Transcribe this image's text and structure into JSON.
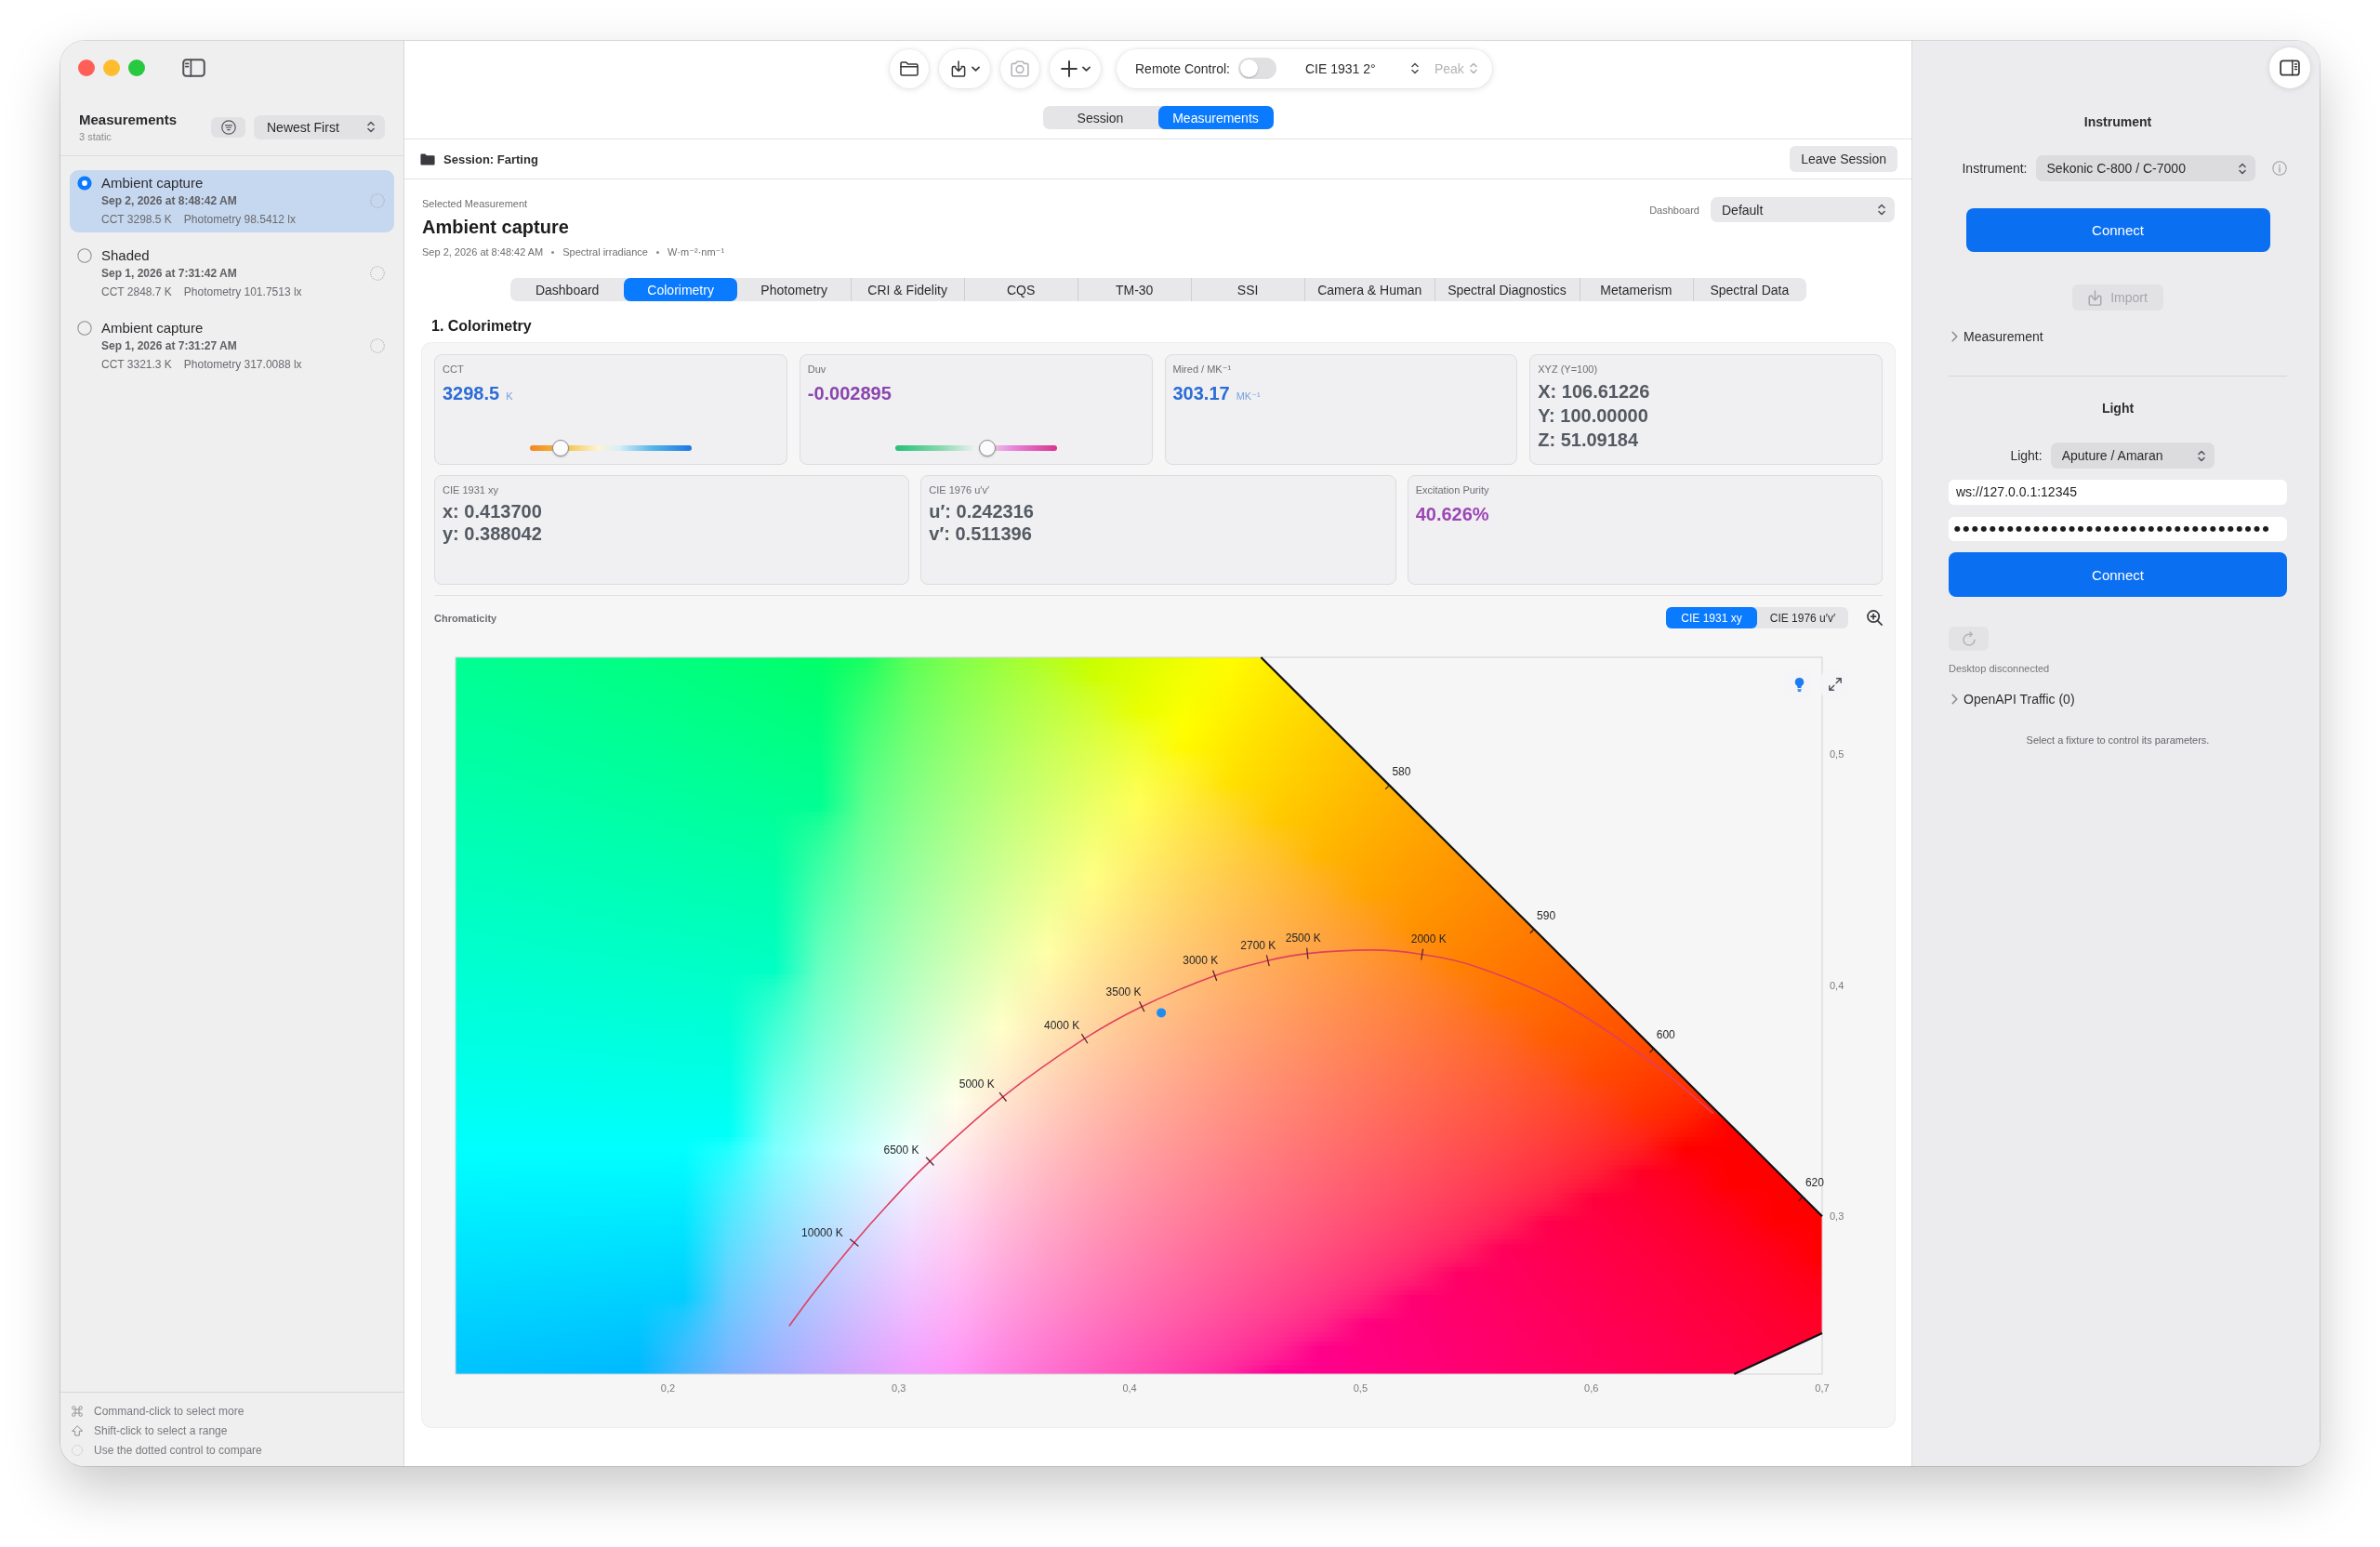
{
  "toolbar": {
    "buttons": [
      {
        "kind": "folder",
        "menu": false,
        "disabled": false
      },
      {
        "kind": "import",
        "menu": true,
        "disabled": false
      },
      {
        "kind": "camera",
        "menu": false,
        "disabled": true
      },
      {
        "kind": "add",
        "menu": true,
        "disabled": false
      }
    ],
    "remote_control": {
      "label": "Remote Control:",
      "on": false
    },
    "observer": "CIE 1931 2°",
    "mode": {
      "value": "Peak",
      "disabled": true
    }
  },
  "view_switch": [
    {
      "label": "Session",
      "selected": false
    },
    {
      "label": "Measurements",
      "selected": true
    }
  ],
  "sidebar": {
    "title": "Measurements",
    "subtitle": "3 static",
    "sort": "Newest First",
    "items": [
      {
        "title": "Ambient capture",
        "date": "Sep 2, 2026 at 8:48:42 AM",
        "cct": "CCT 3298.5 K",
        "photometry": "Photometry 98.5412 lx",
        "selected": true,
        "compared": false
      },
      {
        "title": "Shaded",
        "date": "Sep 1, 2026 at 7:31:42 AM",
        "cct": "CCT 2848.7 K",
        "photometry": "Photometry 101.7513 lx",
        "selected": false,
        "compared": false
      },
      {
        "title": "Ambient capture",
        "date": "Sep 1, 2026 at 7:31:27 AM",
        "cct": "CCT 3321.3 K",
        "photometry": "Photometry 317.0088 lx",
        "selected": false,
        "compared": false
      }
    ],
    "hints": [
      {
        "kind": "command",
        "text": "Command-click to select more"
      },
      {
        "kind": "shift",
        "text": "Shift-click to select a range"
      },
      {
        "kind": "compare",
        "text": "Use the dotted control to compare"
      }
    ]
  },
  "session": {
    "title": "Session: Farting",
    "leave": "Leave Session"
  },
  "measurement": {
    "caption": "Selected Measurement",
    "title": "Ambient capture",
    "meta": [
      "Sep 2, 2026 at 8:48:42 AM",
      "Spectral irradiance",
      "W·m⁻²·nm⁻¹"
    ],
    "dashboard_label": "Dashboard",
    "dashboard": "Default"
  },
  "tabs": [
    {
      "label": "Dashboard",
      "selected": false
    },
    {
      "label": "Colorimetry",
      "selected": true
    },
    {
      "label": "Photometry",
      "selected": false
    },
    {
      "label": "CRI & Fidelity",
      "selected": false
    },
    {
      "label": "CQS",
      "selected": false
    },
    {
      "label": "TM-30",
      "selected": false
    },
    {
      "label": "SSI",
      "selected": false
    },
    {
      "label": "Camera & Human",
      "selected": false
    },
    {
      "label": "Spectral Diagnostics",
      "selected": false
    },
    {
      "label": "Metamerism",
      "selected": false
    },
    {
      "label": "Spectral Data",
      "selected": false
    }
  ],
  "section_title": "1. Colorimetry",
  "metrics": [
    {
      "cards": [
        {
          "kind": "value",
          "label": "CCT",
          "value": "3298.5",
          "unit": "K",
          "color": "#2b6cd6",
          "gauge": {
            "kind": "cct",
            "level": 0.19
          }
        },
        {
          "kind": "value",
          "label": "Duv",
          "value": "-0.002895",
          "color": "#8a45ae",
          "gauge": {
            "kind": "duv",
            "level": 0.57
          }
        },
        {
          "kind": "value",
          "label": "Mired / MK⁻¹",
          "value": "303.17",
          "unit": "MK⁻¹",
          "color": "#2b6cd6"
        },
        {
          "kind": "lines",
          "label": "XYZ (Y=100)",
          "lines": [
            "X: 106.61226",
            "Y: 100.00000",
            "Z: 51.09184"
          ]
        }
      ]
    },
    {
      "cards": [
        {
          "kind": "lines",
          "label": "CIE 1931 xy",
          "lines": [
            "x: 0.413700",
            "y: 0.388042"
          ]
        },
        {
          "kind": "lines",
          "label": "CIE 1976 u′v′",
          "lines": [
            "u′: 0.242316",
            "v′: 0.511396"
          ]
        },
        {
          "kind": "value",
          "label": "Excitation Purity",
          "value": "40.626%",
          "color": "#9c46b6"
        }
      ]
    }
  ],
  "chromaticity": {
    "modes": [
      {
        "label": "CIE 1931 xy",
        "selected": true
      },
      {
        "label": "CIE 1976 u′v′",
        "selected": false
      }
    ],
    "chart_data": {
      "type": "line",
      "title": "Chromaticity",
      "xlim": [
        0.108,
        0.7
      ],
      "ylim": [
        0.2315,
        0.542
      ],
      "xticks": [
        {
          "value": 0.2,
          "label": "0,2"
        },
        {
          "value": 0.3,
          "label": "0,3"
        },
        {
          "value": 0.4,
          "label": "0,4"
        },
        {
          "value": 0.5,
          "label": "0,5"
        },
        {
          "value": 0.6,
          "label": "0,6"
        },
        {
          "value": 0.7,
          "label": "0,7"
        }
      ],
      "yticks": [
        {
          "value": 0.3,
          "label": "0,3"
        },
        {
          "value": 0.4,
          "label": "0,4"
        },
        {
          "value": 0.5,
          "label": "0,5"
        }
      ],
      "series": [
        {
          "color": "#111111",
          "x": [
            0.4569,
            0.4788,
            0.5125,
            0.5448,
            0.5752,
            0.6029,
            0.627,
            0.6482,
            0.6658,
            0.6801,
            0.6915,
            0.7
          ],
          "values": [
            0.542,
            0.5202,
            0.4866,
            0.4544,
            0.4242,
            0.3965,
            0.3725,
            0.3514,
            0.334,
            0.3197,
            0.3083,
            0.2999
          ]
        },
        {
          "color": "#111111",
          "x": [
            0.6619,
            0.7
          ],
          "values": [
            0.2315,
            0.2492
          ]
        },
        {
          "color": "#e0405e",
          "x": [
            0.2525,
            0.2637,
            0.2807,
            0.2952,
            0.3135,
            0.3451,
            0.3805,
            0.4053,
            0.4369,
            0.4599,
            0.477,
            0.5056,
            0.5267,
            0.5494,
            0.5857,
            0.6251,
            0.6528
          ],
          "values": [
            0.2523,
            0.2674,
            0.2884,
            0.3048,
            0.3237,
            0.3516,
            0.3768,
            0.3907,
            0.4041,
            0.4106,
            0.4137,
            0.4152,
            0.4133,
            0.4082,
            0.3931,
            0.3674,
            0.3444
          ]
        },
        {
          "color": "#1f8cf0",
          "marker": "circle",
          "x": [
            0.4137
          ],
          "values": [
            0.388
          ]
        }
      ],
      "annotations": [
        {
          "text": "580",
          "x": 0.5125,
          "y": 0.4866
        },
        {
          "text": "590",
          "x": 0.5752,
          "y": 0.4242
        },
        {
          "text": "600",
          "x": 0.627,
          "y": 0.3725
        },
        {
          "text": "620",
          "x": 0.6915,
          "y": 0.3083
        },
        {
          "text": "10000 K",
          "x": 0.2807,
          "y": 0.2884
        },
        {
          "text": "6500 K",
          "x": 0.3135,
          "y": 0.3237
        },
        {
          "text": "5000 K",
          "x": 0.3451,
          "y": 0.3516
        },
        {
          "text": "4000 K",
          "x": 0.3805,
          "y": 0.3768
        },
        {
          "text": "3500 K",
          "x": 0.4053,
          "y": 0.3907
        },
        {
          "text": "3000 K",
          "x": 0.4369,
          "y": 0.4041
        },
        {
          "text": "2700 K",
          "x": 0.4599,
          "y": 0.4106
        },
        {
          "text": "2500 K",
          "x": 0.477,
          "y": 0.4137
        },
        {
          "text": "2000 K",
          "x": 0.5267,
          "y": 0.4133
        }
      ]
    }
  },
  "inspector": {
    "instrument": {
      "heading": "Instrument",
      "label": "Instrument:",
      "device": "Sekonic C-800 / C-7000",
      "connect": "Connect",
      "import": {
        "label": "Import",
        "disabled": true
      },
      "disclosure": {
        "label": "Measurement",
        "expanded": false
      }
    },
    "light": {
      "heading": "Light",
      "label": "Light:",
      "device": "Aputure / Amaran",
      "url": "ws://127.0.0.1:12345",
      "password": "●●●●●●●●●●●●●●●●●●●●●●●●●●●●●●●●●●●●",
      "connect": "Connect",
      "refresh_disabled": true,
      "status": "Desktop disconnected",
      "traffic": {
        "label": "OpenAPI Traffic (0)",
        "expanded": false
      },
      "note": "Select a fixture to control its parameters."
    }
  }
}
